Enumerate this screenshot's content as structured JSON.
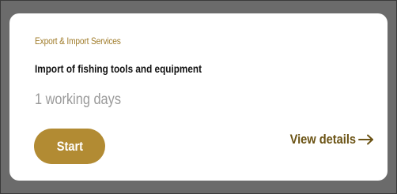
{
  "service_card": {
    "category": "Export & Import Services",
    "title": "Import of fishing tools and equipment",
    "duration": "1 working days",
    "start_label": "Start",
    "view_details_label": "View details",
    "arrow_icon": "arrow-right-icon"
  },
  "colors": {
    "accent": "#b28b33",
    "category_text": "#a07c2a",
    "link_text": "#6b5314",
    "muted_text": "#9a9a9a",
    "backdrop": "#6b6b6b"
  }
}
